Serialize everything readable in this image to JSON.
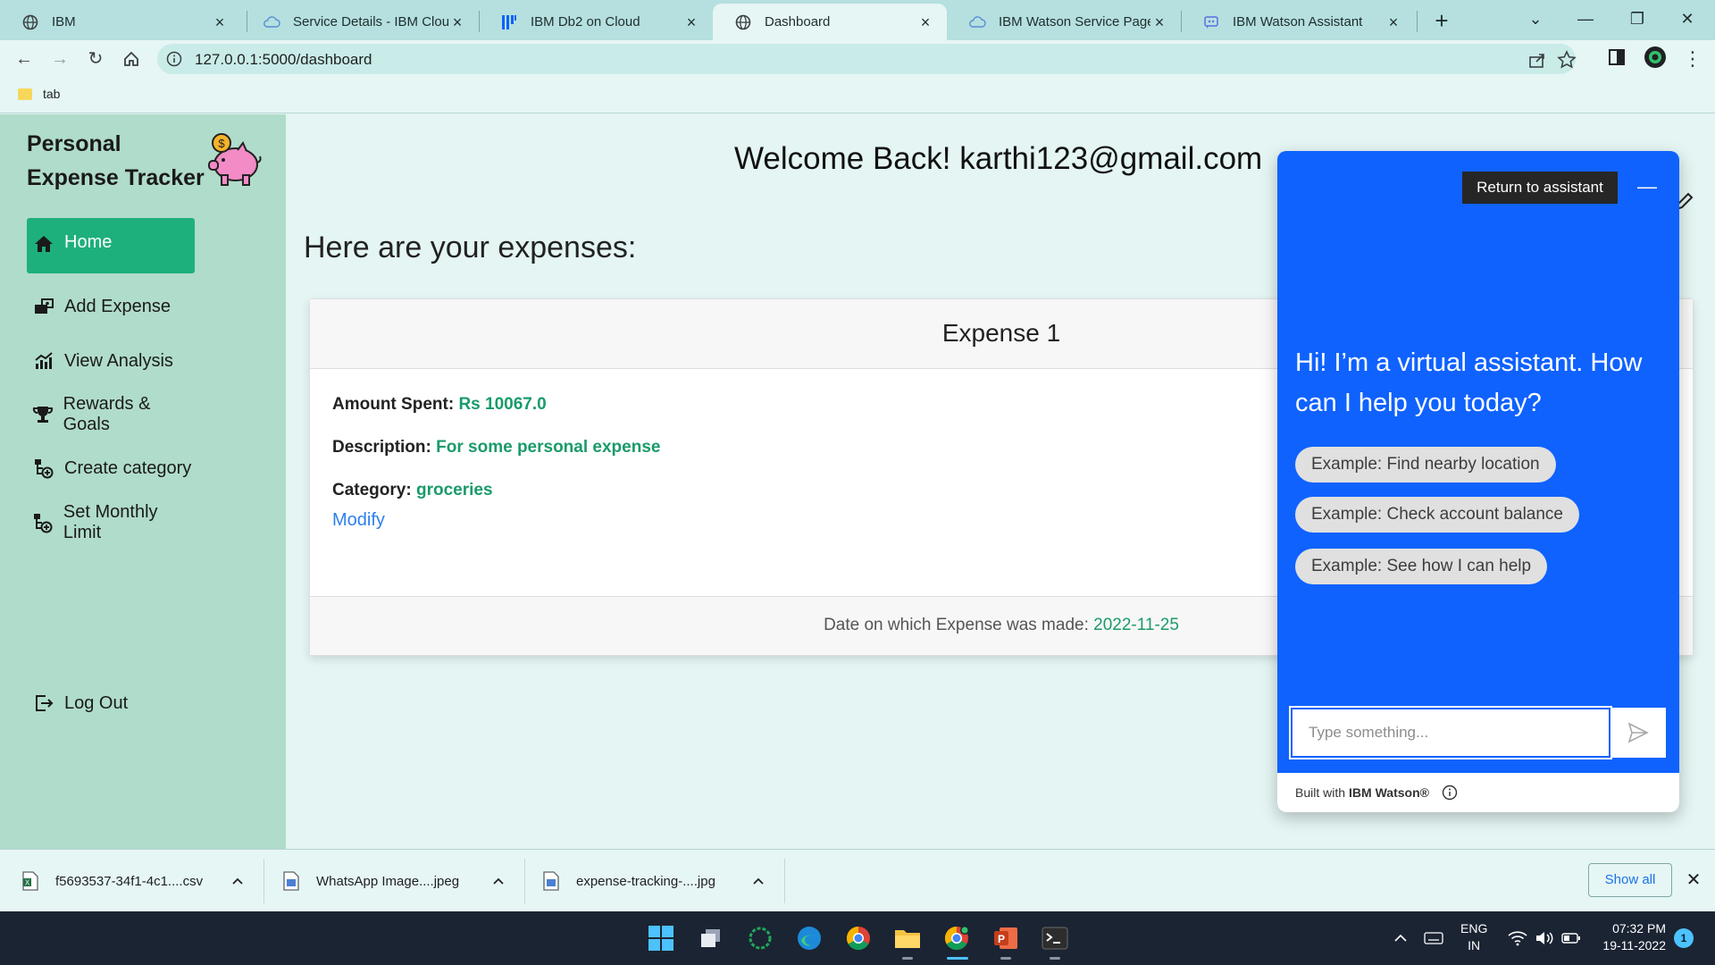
{
  "browser": {
    "tabs": [
      {
        "title": "IBM",
        "icon": "globe-icon"
      },
      {
        "title": "Service Details - IBM Cloud",
        "icon": "cloud-icon"
      },
      {
        "title": "IBM Db2 on Cloud",
        "icon": "db2-icon"
      },
      {
        "title": "Dashboard",
        "icon": "globe-icon",
        "active": true
      },
      {
        "title": "IBM Watson Service Page",
        "icon": "cloud-icon"
      },
      {
        "title": "IBM Watson Assistant",
        "icon": "watson-icon"
      }
    ],
    "new_tab": "+",
    "window_controls": {
      "tab_search": "⌄",
      "minimize": "—",
      "restore": "❐",
      "close": "✕"
    },
    "url": "127.0.0.1:5000/dashboard",
    "bookmarks": [
      {
        "label": "tab"
      }
    ]
  },
  "sidebar": {
    "brand_line1": "Personal",
    "brand_line2": "Expense Tracker",
    "items": [
      {
        "label": "Home",
        "icon": "home-icon"
      },
      {
        "label": "Add Expense",
        "icon": "add-expense-icon"
      },
      {
        "label": "View Analysis",
        "icon": "chart-icon"
      },
      {
        "label": "Rewards & Goals",
        "icon": "trophy-icon"
      },
      {
        "label": "Create category",
        "icon": "category-icon"
      },
      {
        "label": "Set Monthly Limit",
        "icon": "limit-icon"
      }
    ],
    "logout": "Log Out"
  },
  "main": {
    "welcome": "Welcome Back! karthi123@gmail.com",
    "heading": "Here are your expenses:",
    "expense": {
      "title": "Expense 1",
      "amount_label": "Amount Spent:",
      "amount_value": "Rs 10067.0",
      "description_label": "Description:",
      "description_value": "For some personal expense",
      "category_label": "Category:",
      "category_value": "groceries",
      "modify": "Modify",
      "date_label": "Date on which Expense was made:",
      "date_value": "2022-11-25"
    }
  },
  "watson": {
    "return_button": "Return to assistant",
    "minimize": "—",
    "greeting": "Hi! I’m a virtual assistant. How can I help you today?",
    "suggestions": [
      "Example: Find nearby location",
      "Example: Check account balance",
      "Example: See how I can help"
    ],
    "input_placeholder": "Type something...",
    "footer_prefix": "Built with",
    "footer_brand": "IBM Watson®"
  },
  "downloads": {
    "items": [
      {
        "name": "f5693537-34f1-4c1....csv",
        "icon": "excel-file-icon"
      },
      {
        "name": "WhatsApp Image....jpeg",
        "icon": "image-file-icon"
      },
      {
        "name": "expense-tracking-....jpg",
        "icon": "image-file-icon"
      }
    ],
    "show_all": "Show all",
    "close": "✕"
  },
  "taskbar": {
    "lang_line1": "ENG",
    "lang_line2": "IN",
    "time": "07:32 PM",
    "date": "19-11-2022",
    "notifications": "1"
  },
  "colors": {
    "accent_green": "#1eb07c",
    "value_green": "#1a9b6a",
    "sidebar_bg": "#b0dccb",
    "watson_blue": "#0f62fe",
    "link_blue": "#2f80ed"
  }
}
